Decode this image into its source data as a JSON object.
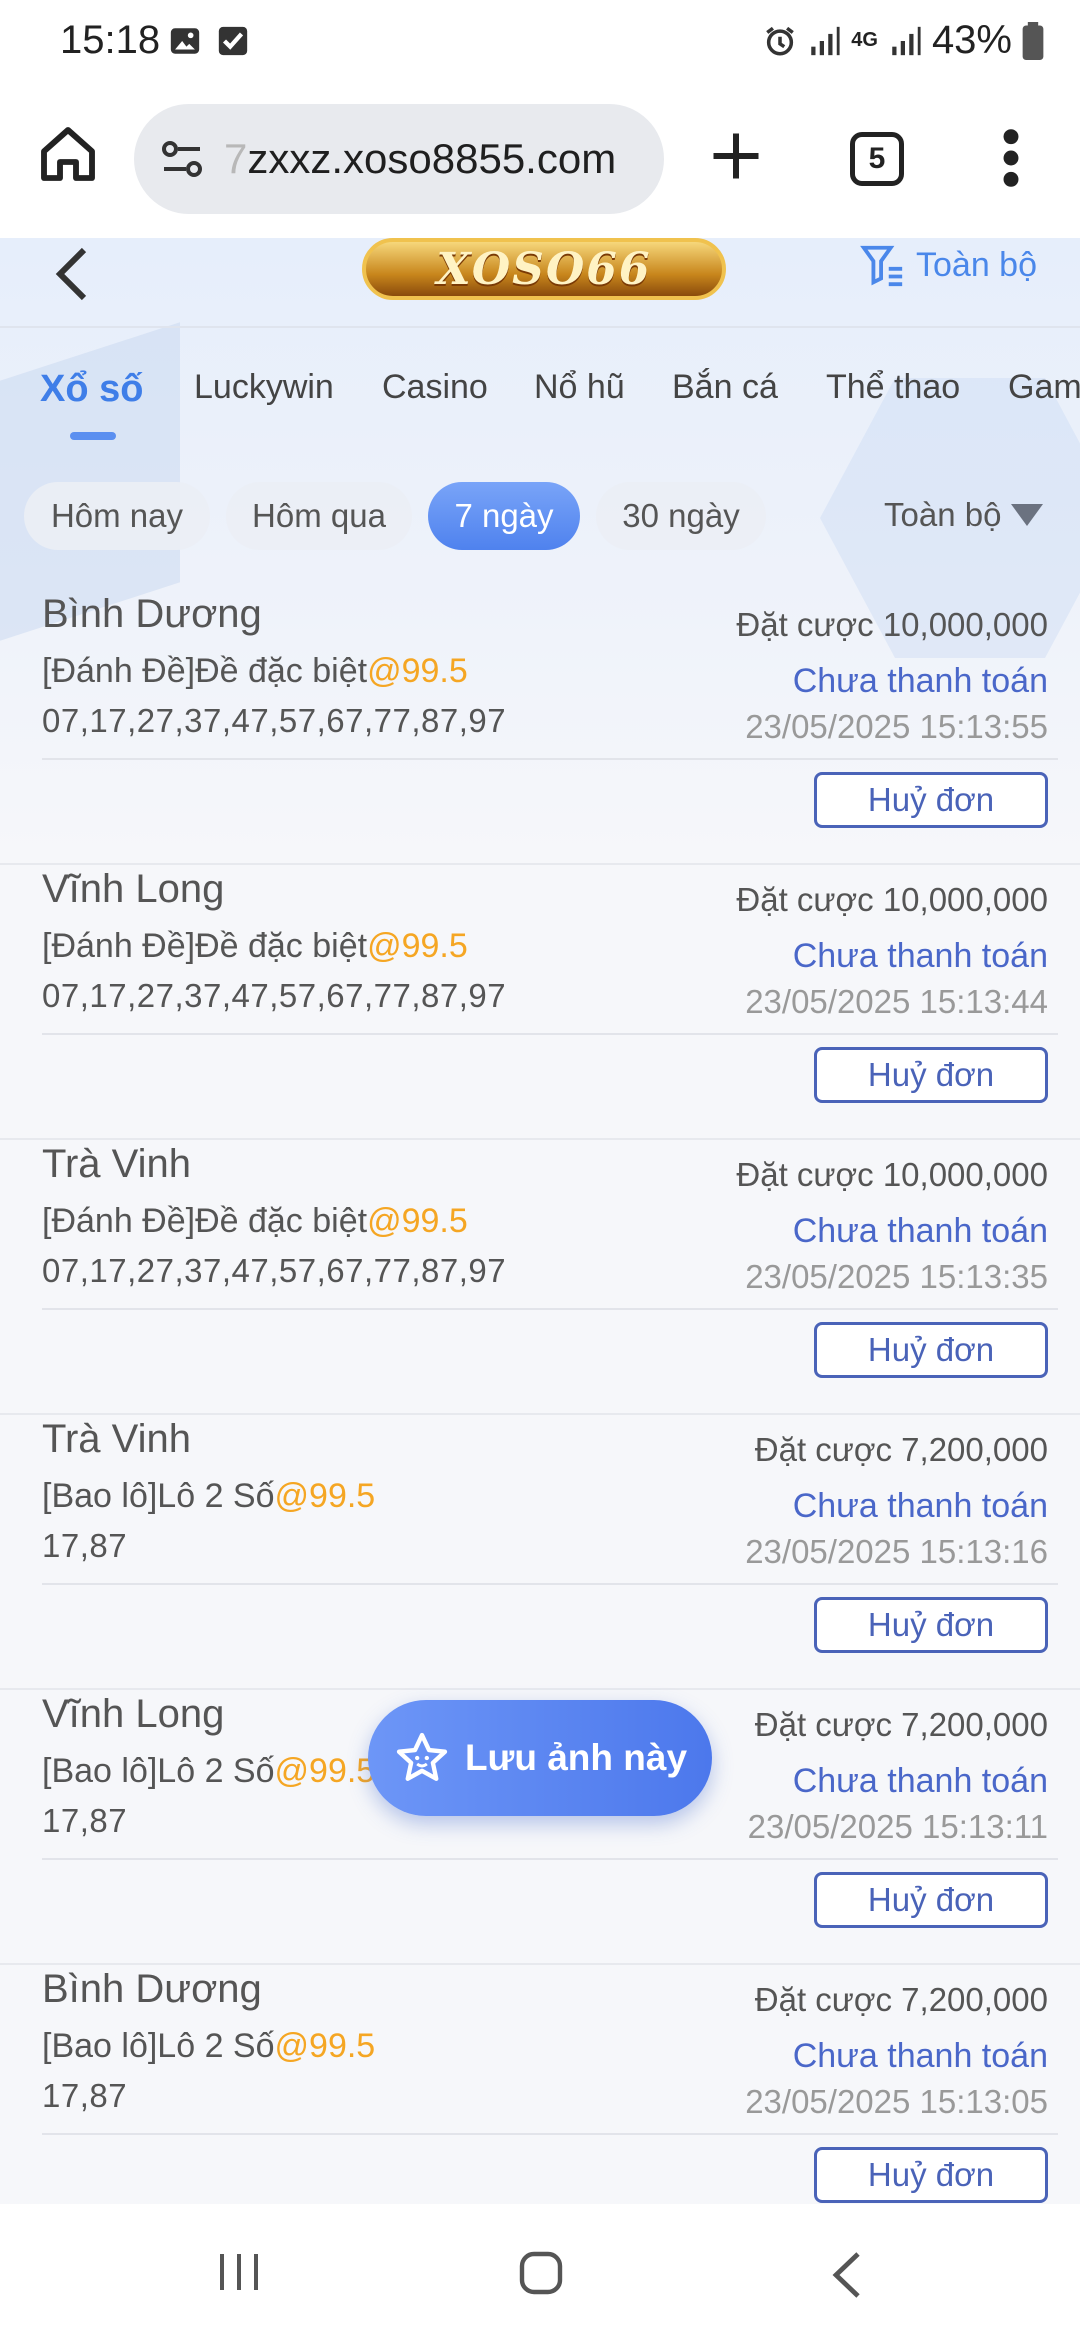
{
  "status_bar": {
    "time": "15:18",
    "network": "4G",
    "battery": "43%",
    "icons": [
      "image-icon",
      "check-box-icon",
      "alarm-icon",
      "signal-icon",
      "signal-4g-icon",
      "signal-icon",
      "battery-icon"
    ]
  },
  "browser": {
    "url_faded": "7",
    "url_main": "zxxz.xoso8855.com",
    "tab_count": "5",
    "icons": [
      "home-icon",
      "site-settings-icon",
      "new-tab-icon",
      "tabs-icon",
      "more-menu-icon"
    ]
  },
  "header": {
    "logo_text": "XOSO66",
    "filter_label": "Toàn bộ"
  },
  "categories": [
    "Xổ số",
    "Luckywin",
    "Casino",
    "Nổ hũ",
    "Bắn cá",
    "Thể thao",
    "Gam"
  ],
  "active_category": "Xổ số",
  "date_filters": [
    "Hôm nay",
    "Hôm qua",
    "7 ngày",
    "30 ngày"
  ],
  "active_date_filter": "7 ngày",
  "range_select": "Toàn bộ",
  "bets": [
    {
      "province": "Bình Dương",
      "type_prefix": "[Đánh Đề]Đề đặc biệt",
      "odds": "@99.5",
      "numbers": "07,17,27,37,47,57,67,77,87,97",
      "amount": "Đặt cược 10,000,000",
      "status": "Chưa thanh toán",
      "time": "23/05/2025 15:13:55",
      "cancel_label": "Huỷ đơn"
    },
    {
      "province": "Vĩnh Long",
      "type_prefix": "[Đánh Đề]Đề đặc biệt",
      "odds": "@99.5",
      "numbers": "07,17,27,37,47,57,67,77,87,97",
      "amount": "Đặt cược 10,000,000",
      "status": "Chưa thanh toán",
      "time": "23/05/2025 15:13:44",
      "cancel_label": "Huỷ đơn"
    },
    {
      "province": "Trà Vinh",
      "type_prefix": "[Đánh Đề]Đề đặc biệt",
      "odds": "@99.5",
      "numbers": "07,17,27,37,47,57,67,77,87,97",
      "amount": "Đặt cược 10,000,000",
      "status": "Chưa thanh toán",
      "time": "23/05/2025 15:13:35",
      "cancel_label": "Huỷ đơn"
    },
    {
      "province": "Trà Vinh",
      "type_prefix": "[Bao lô]Lô 2 Số",
      "odds": "@99.5",
      "numbers": "17,87",
      "amount": "Đặt cược 7,200,000",
      "status": "Chưa thanh toán",
      "time": "23/05/2025 15:13:16",
      "cancel_label": "Huỷ đơn"
    },
    {
      "province": "Vĩnh Long",
      "type_prefix": "[Bao lô]Lô 2 Số",
      "odds": "@99.5",
      "numbers": "17,87",
      "amount": "Đặt cược 7,200,000",
      "status": "Chưa thanh toán",
      "time": "23/05/2025 15:13:11",
      "cancel_label": "Huỷ đơn"
    },
    {
      "province": "Bình Dương",
      "type_prefix": "[Bao lô]Lô 2 Số",
      "odds": "@99.5",
      "numbers": "17,87",
      "amount": "Đặt cược 7,200,000",
      "status": "Chưa thanh toán",
      "time": "23/05/2025 15:13:05",
      "cancel_label": "Huỷ đơn"
    }
  ],
  "save_button": {
    "label": "Lưu ảnh này",
    "icon": "star-icon"
  },
  "colors": {
    "accent": "#4f82ee",
    "odds": "#f5a623",
    "status": "#4a67c9",
    "cancel_border": "#4a63b8"
  }
}
